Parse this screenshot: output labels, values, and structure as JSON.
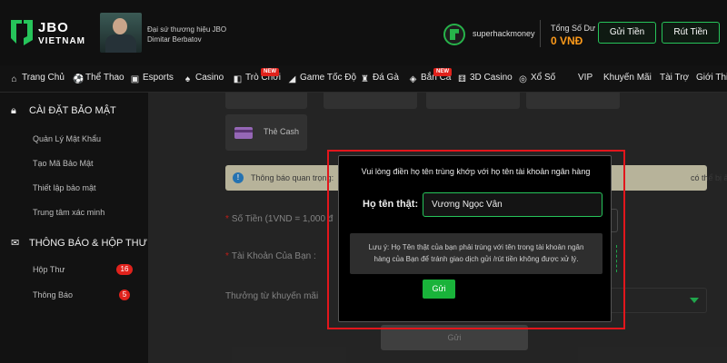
{
  "brand": {
    "line1": "JBO",
    "line2": "VIETNAM"
  },
  "ambassador": {
    "line1": "Đại sứ thương hiệu JBO",
    "line2": "Dimitar Berbatov"
  },
  "account": {
    "username": "superhackmoney",
    "balance_label": "Tổng Số Dư",
    "balance_value": "0 VNĐ",
    "deposit_label": "Gửi Tiền",
    "withdraw_label": "Rút Tiền"
  },
  "nav": {
    "items": [
      {
        "label": "Trang Chủ",
        "icon": "home-icon"
      },
      {
        "label": "Thể Thao",
        "icon": "soccer-ball-icon"
      },
      {
        "label": "Esports",
        "icon": "gamepad-icon"
      },
      {
        "label": "Casino",
        "icon": "cards-icon"
      },
      {
        "label": "Trò Chơi",
        "icon": "slot-icon",
        "badge": "NEW"
      },
      {
        "label": "Game Tốc Độ",
        "icon": "speed-icon"
      },
      {
        "label": "Đá Gà",
        "icon": "rooster-icon"
      },
      {
        "label": "Bắn Cá",
        "icon": "fish-icon",
        "badge": "NEW"
      },
      {
        "label": "3D Casino",
        "icon": "dice-icon"
      },
      {
        "label": "Xổ Số",
        "icon": "lottery-icon"
      },
      {
        "label": "VIP"
      },
      {
        "label": "Khuyến Mãi"
      },
      {
        "label": "Tài Trợ"
      },
      {
        "label": "Giới Thi"
      }
    ]
  },
  "sidebar": {
    "security_heading": "CÀI ĐẶT BẢO MẬT",
    "security_items": [
      "Quản Lý Mật Khẩu",
      "Tạo Mã Bảo Mật",
      "Thiết lập bảo mật",
      "Trung tâm xác minh"
    ],
    "messages_heading": "THÔNG BÁO & HỘP THƯ",
    "inbox_label": "Hộp Thư",
    "inbox_count": "16",
    "notice_label": "Thông Báo",
    "notice_count": "5"
  },
  "main": {
    "card_label": "Thẻ Cash",
    "notice_text": "Thông báo quan trọng:",
    "notice_tail": "có thể bị ảnh hưởng.",
    "amount_label": "Số Tiền (1VND = 1,000 đ",
    "account_label": "Tài Khoản Của Bạn :",
    "promo_label": "Thưởng từ khuyến mãi",
    "submit_label": "Gửi"
  },
  "modal": {
    "title": "Vui lòng điền họ tên trùng khớp với họ tên tài khoản ngân hàng",
    "name_label": "Họ tên thật:",
    "name_value": "Vương Ngọc Vân",
    "note_line1": "Lưu ý: Họ Tên thật của bạn phải trùng với tên trong tài khoản ngân",
    "note_line2": "hàng của Bạn để tránh giao dịch gửi /rút tiền không được xử lý.",
    "submit_label": "Gửi"
  },
  "colors": {
    "accent_green": "#26c45a",
    "highlight_red": "#e2161c",
    "balance_orange": "#ff9b1a"
  }
}
